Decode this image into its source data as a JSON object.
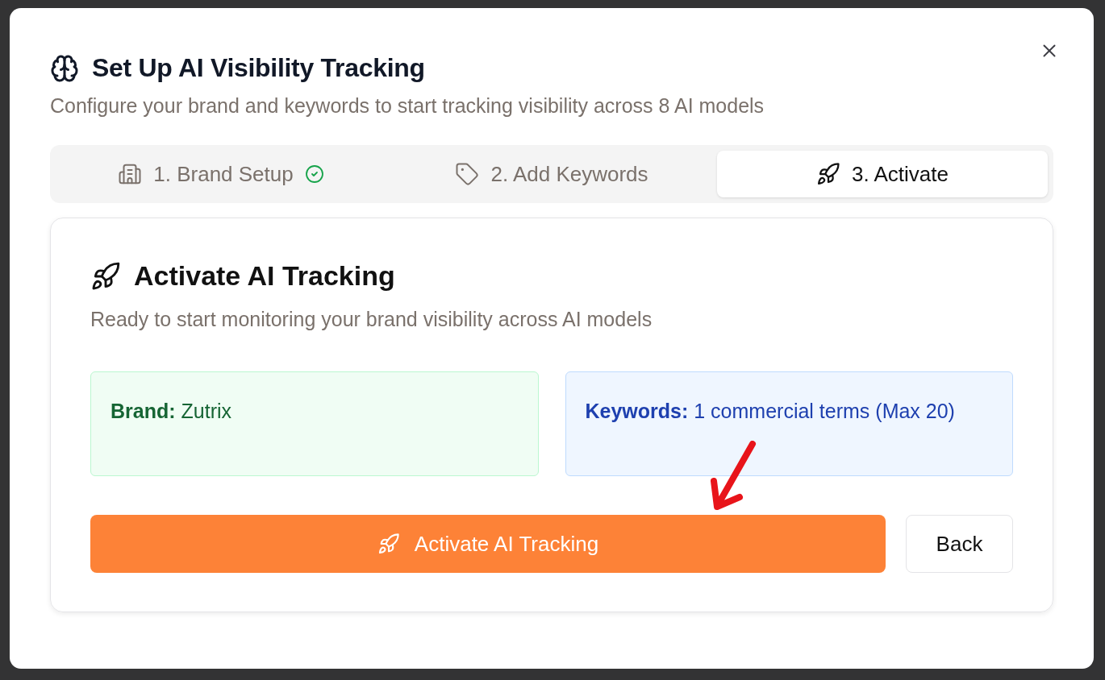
{
  "dialog": {
    "title": "Set Up AI Visibility Tracking",
    "subtitle": "Configure your brand and keywords to start tracking visibility across 8 AI models"
  },
  "steps": [
    {
      "label": "1. Brand Setup",
      "kind": "brand",
      "selected": false,
      "completed": true
    },
    {
      "label": "2. Add Keywords",
      "kind": "keywords",
      "selected": false,
      "completed": false
    },
    {
      "label": "3. Activate",
      "kind": "activate",
      "selected": true,
      "completed": false
    }
  ],
  "panel": {
    "title": "Activate AI Tracking",
    "description": "Ready to start monitoring your brand visibility across AI models",
    "summary": [
      {
        "kind": "brand",
        "label": "Brand:",
        "value": "Zutrix"
      },
      {
        "kind": "keywords",
        "label": "Keywords:",
        "value": "1 commercial terms (Max 20)"
      }
    ],
    "actions": [
      {
        "kind": "primary",
        "label": "Activate AI Tracking"
      },
      {
        "kind": "secondary",
        "label": "Back"
      }
    ]
  }
}
